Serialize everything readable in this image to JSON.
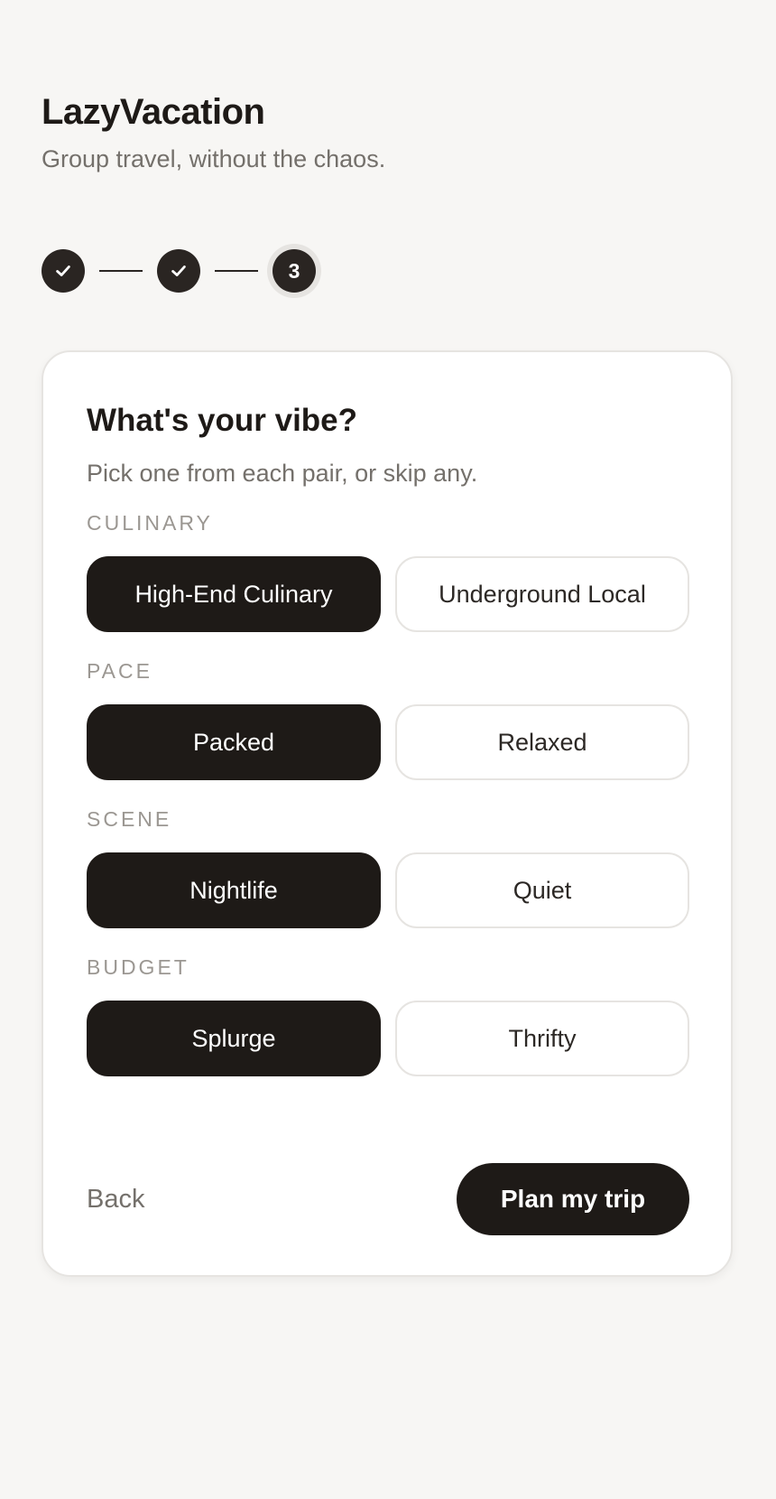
{
  "app": {
    "title": "LazyVacation",
    "tagline": "Group travel, without the chaos."
  },
  "stepper": {
    "steps": [
      {
        "state": "complete",
        "icon": "check-icon"
      },
      {
        "state": "complete",
        "icon": "check-icon"
      },
      {
        "state": "current",
        "label": "3"
      }
    ]
  },
  "card": {
    "title": "What's your vibe?",
    "subtitle": "Pick one from each pair, or skip any.",
    "categories": [
      {
        "label": "CULINARY",
        "options": [
          "High-End Culinary",
          "Underground Local"
        ],
        "selected": 0
      },
      {
        "label": "PACE",
        "options": [
          "Packed",
          "Relaxed"
        ],
        "selected": 0
      },
      {
        "label": "SCENE",
        "options": [
          "Nightlife",
          "Quiet"
        ],
        "selected": 0
      },
      {
        "label": "BUDGET",
        "options": [
          "Splurge",
          "Thrifty"
        ],
        "selected": 0
      }
    ],
    "back_label": "Back",
    "submit_label": "Plan my trip"
  },
  "colors": {
    "background": "#f7f6f4",
    "primary": "#1e1a17",
    "muted_text": "#74706b",
    "border": "#e6e4e1"
  }
}
